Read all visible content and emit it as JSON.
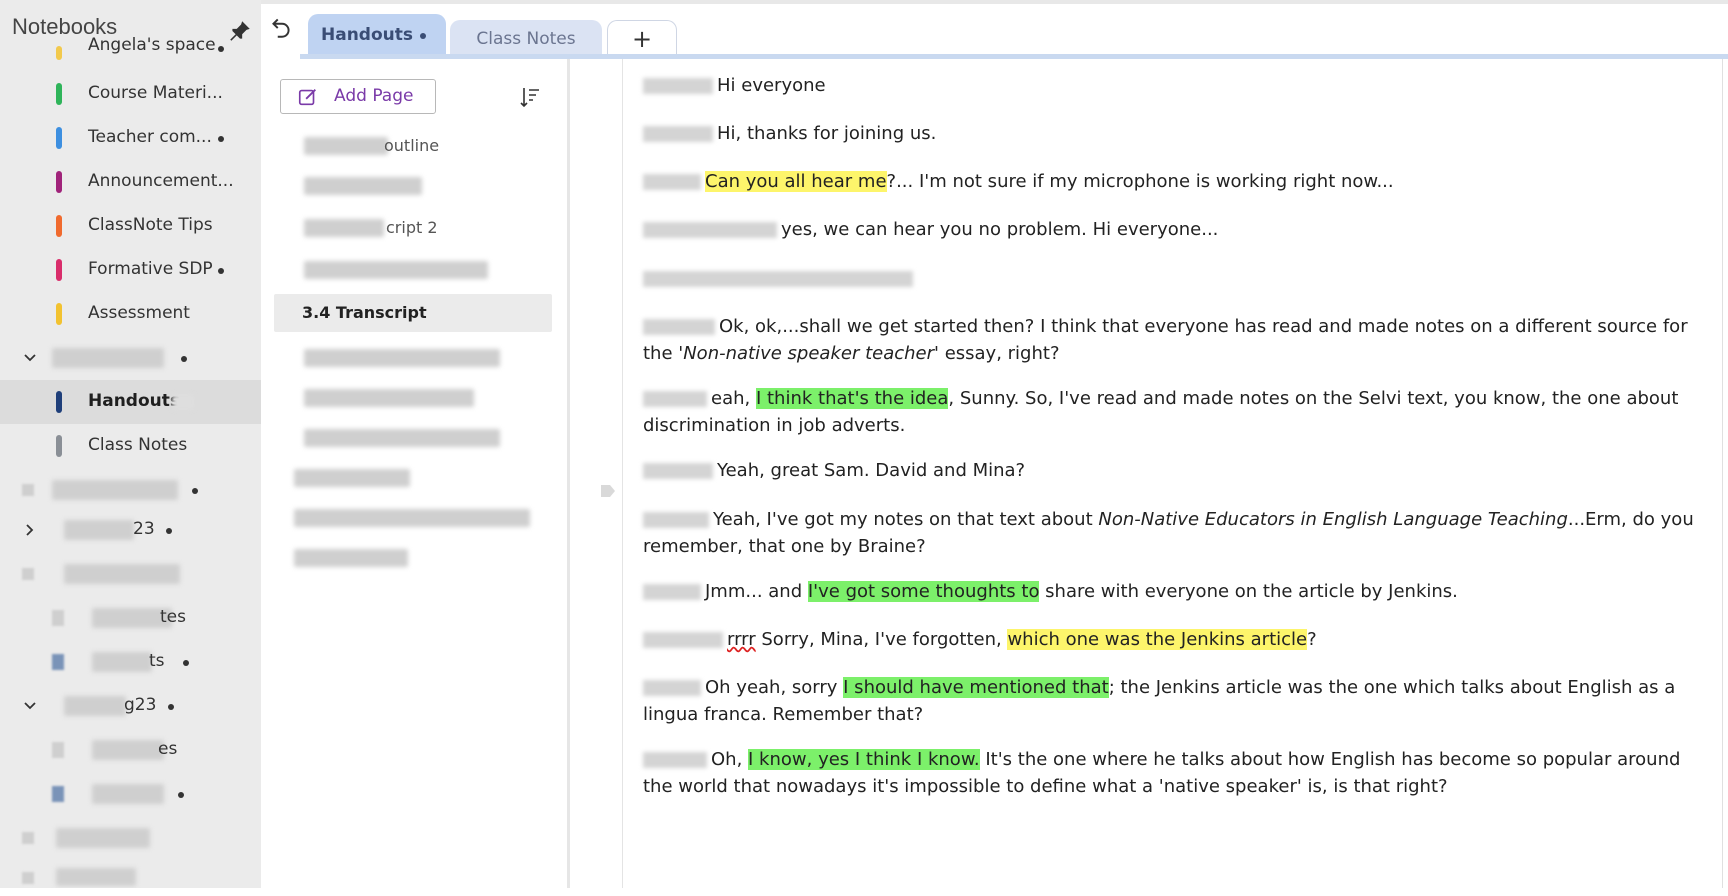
{
  "notebooks_pane": {
    "title": "Notebooks",
    "sections": [
      {
        "label": "Angela's space",
        "color": "#f2c94c",
        "dot": true
      },
      {
        "label": "Course Materi...",
        "color": "#2fb45a",
        "dot": false
      },
      {
        "label": "Teacher com...",
        "color": "#3d8fe0",
        "dot": true
      },
      {
        "label": "Announcement...",
        "color": "#a0237a",
        "dot": false
      },
      {
        "label": "ClassNote Tips",
        "color": "#f06a2e",
        "dot": false
      },
      {
        "label": "Formative SDP",
        "color": "#d92d6b",
        "dot": true
      },
      {
        "label": "Assessment",
        "color": "#f2c230",
        "dot": false
      },
      {
        "label": "Handouts",
        "color": "#1f3f7a",
        "dot": false
      },
      {
        "label": "Class Notes",
        "color": "#8a8f96",
        "dot": false
      }
    ],
    "partial_labels": {
      "notes": "tes",
      "its": "ts",
      "g23": "g23",
      "c23": "23",
      "es": "es"
    }
  },
  "tabbar": {
    "tabs": [
      {
        "label": "Handouts"
      },
      {
        "label": "Class Notes"
      }
    ],
    "add_label": "+"
  },
  "page_list": {
    "add_page_label": "Add Page",
    "pages": [
      {
        "label": "outline"
      },
      {
        "label": "cript 2"
      },
      {
        "label": "3.4 Transcript"
      }
    ]
  },
  "transcript": {
    "lines": [
      {
        "pre": "Hi everyone",
        "hl": "",
        "hl_color": "",
        "post": ""
      },
      {
        "pre": "Hi, thanks for joining us.",
        "hl": "",
        "hl_color": "",
        "post": ""
      },
      {
        "pre": "",
        "hl": "Can you all hear me",
        "hl_color": "yellow",
        "post": "?... I'm not sure if my microphone is working right now..."
      },
      {
        "pre": "yes, we can hear you no problem. Hi everyone...",
        "hl": "",
        "hl_color": "",
        "post": ""
      },
      {
        "pre": "Ok, ok,...shall we get started then? I think that everyone has read and made notes on a different source for the ",
        "italic": "'Non-native speaker teacher'",
        "post2": " essay, right?"
      },
      {
        "pre": "eah, ",
        "hl": "I think that's the idea",
        "hl_color": "green",
        "post": ", Sunny. So, I've read and made notes on the Selvi text, you know, the one about discrimination in job adverts."
      },
      {
        "pre": "Yeah, great Sam. David and Mina?",
        "hl": "",
        "hl_color": "",
        "post": ""
      },
      {
        "pre": "Yeah, I've got my notes on that text about ",
        "italic": "Non-Native Educators in English Language Teaching",
        "post2": "...Erm, do you remember, that one by Braine?"
      },
      {
        "pre": "Jmm... and ",
        "hl": "I've got some thoughts to",
        "hl_color": "green",
        "post": " share with everyone on the article by Jenkins."
      },
      {
        "pre_red": "rrrr",
        "pre": " Sorry, Mina, I've forgotten, ",
        "hl": "which one was the Jenkins article",
        "hl_color": "yellow",
        "post": "?"
      },
      {
        "pre": "Oh yeah, sorry ",
        "hl": "I should have mentioned that",
        "hl_color": "green",
        "post": "; the Jenkins article was the one which talks about English as a lingua franca. Remember that?"
      },
      {
        "pre": "Oh, ",
        "hl": "I know, yes I think I know.",
        "hl_color": "green",
        "post": " It's the one where he talks about how English has become so popular around the world that nowadays it's impossible to define what a 'native speaker' is, is that right?"
      }
    ]
  },
  "colors": {
    "highlight_yellow": "#fdf56b",
    "highlight_green": "#7cf06a",
    "active_tab": "#bfd3f2",
    "add_page_text": "#7a3aa8"
  }
}
